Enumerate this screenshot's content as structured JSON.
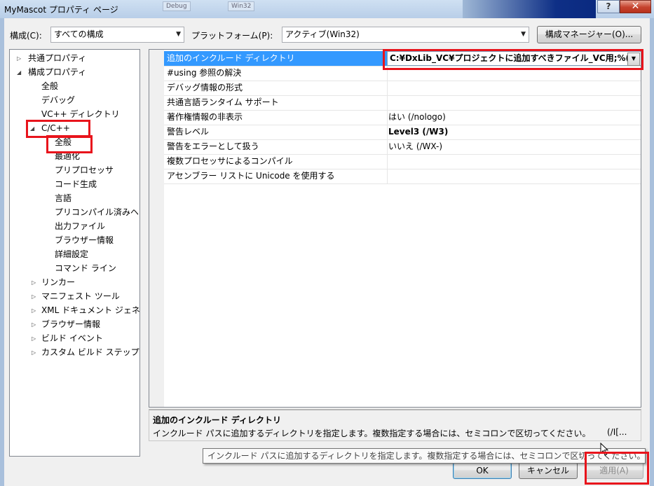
{
  "window": {
    "title": "MyMascot プロパティ ページ",
    "bg_tabs": [
      "Debug",
      "Win32"
    ],
    "help_label": "?",
    "close_label": "✕"
  },
  "toolbar": {
    "config_label": "構成(C):",
    "config_value": "すべての構成",
    "platform_label": "プラットフォーム(P):",
    "platform_value": "アクティブ(Win32)",
    "config_manager_label": "構成マネージャー(O)..."
  },
  "tree": {
    "common_props": "共通プロパティ",
    "config_props": "構成プロパティ",
    "items": {
      "general": "全般",
      "debug": "デバッグ",
      "vcdirs": "VC++ ディレクトリ",
      "cpp": "C/C++",
      "cpp_general": "全般",
      "optimization": "最適化",
      "preprocessor": "プリプロセッサ",
      "codegen": "コード生成",
      "language": "言語",
      "pch": "プリコンパイル済みヘ",
      "output": "出力ファイル",
      "browse": "ブラウザー情報",
      "advanced": "詳細設定",
      "cmdline": "コマンド ライン",
      "linker": "リンカー",
      "manifest": "マニフェスト ツール",
      "xmldoc": "XML ドキュメント ジェネ",
      "browse_info": "ブラウザー情報",
      "build_events": "ビルド イベント",
      "custom_build": "カスタム ビルド ステップ"
    }
  },
  "grid": {
    "rows": [
      {
        "name": "追加のインクルード ディレクトリ",
        "value": "C:¥DxLib_VC¥プロジェクトに追加すべきファイル_VC用;%("
      },
      {
        "name": "#using 参照の解決",
        "value": ""
      },
      {
        "name": "デバッグ情報の形式",
        "value": ""
      },
      {
        "name": "共通言語ランタイム サポート",
        "value": ""
      },
      {
        "name": "著作権情報の非表示",
        "value": "はい (/nologo)"
      },
      {
        "name": "警告レベル",
        "value": "Level3 (/W3)"
      },
      {
        "name": "警告をエラーとして扱う",
        "value": "いいえ (/WX-)"
      },
      {
        "name": "複数プロセッサによるコンパイル",
        "value": ""
      },
      {
        "name": "アセンブラー リストに Unicode を使用する",
        "value": ""
      }
    ]
  },
  "description": {
    "title": "追加のインクルード ディレクトリ",
    "text": "インクルード パスに追加するディレクトリを指定します。複数指定する場合には、セミコロンで区切ってください。",
    "suffix": "(/I[..."
  },
  "tooltip": {
    "text": "インクルード パスに追加するディレクトリを指定します。複数指定する場合には、セミコロンで区切ってください。"
  },
  "buttons": {
    "ok": "OK",
    "cancel": "キャンセル",
    "apply": "適用(A)"
  },
  "colors": {
    "selection": "#3399ff",
    "highlight_box": "#e8141c"
  }
}
